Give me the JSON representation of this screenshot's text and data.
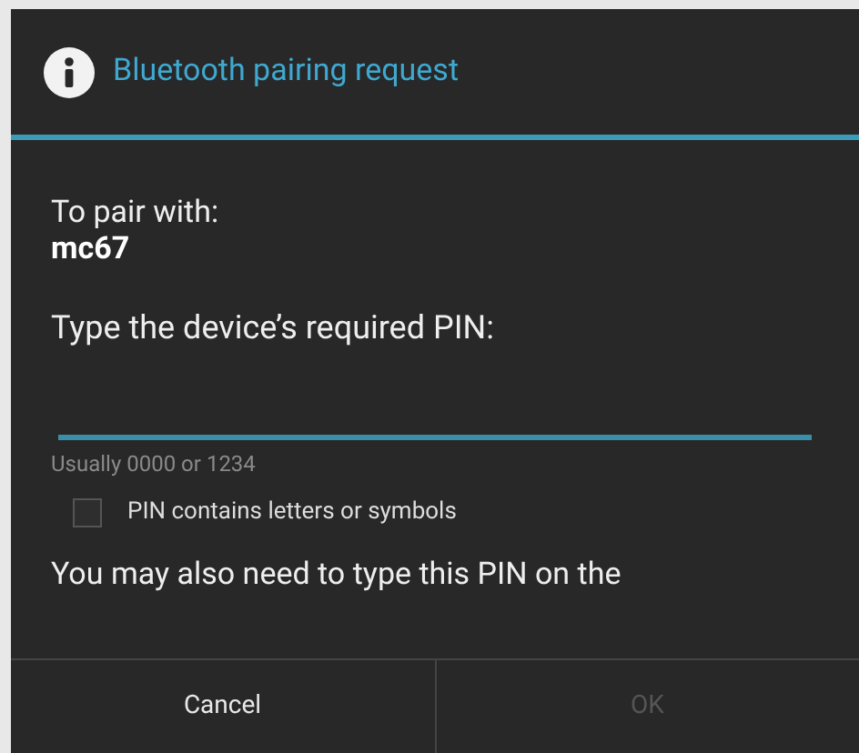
{
  "dialog": {
    "title": "Bluetooth pairing request"
  },
  "body": {
    "label": "To pair with:",
    "device": "mc67",
    "prompt": "Type the device’s required PIN:"
  },
  "hint": "Usually 0000 or 1234",
  "checkbox": {
    "label": "PIN contains letters or symbols",
    "checked": false
  },
  "note": "You may also need to type this PIN on the",
  "buttons": [
    {
      "label": "Cancel",
      "disabled": false
    },
    {
      "label": "OK",
      "disabled": true
    }
  ]
}
